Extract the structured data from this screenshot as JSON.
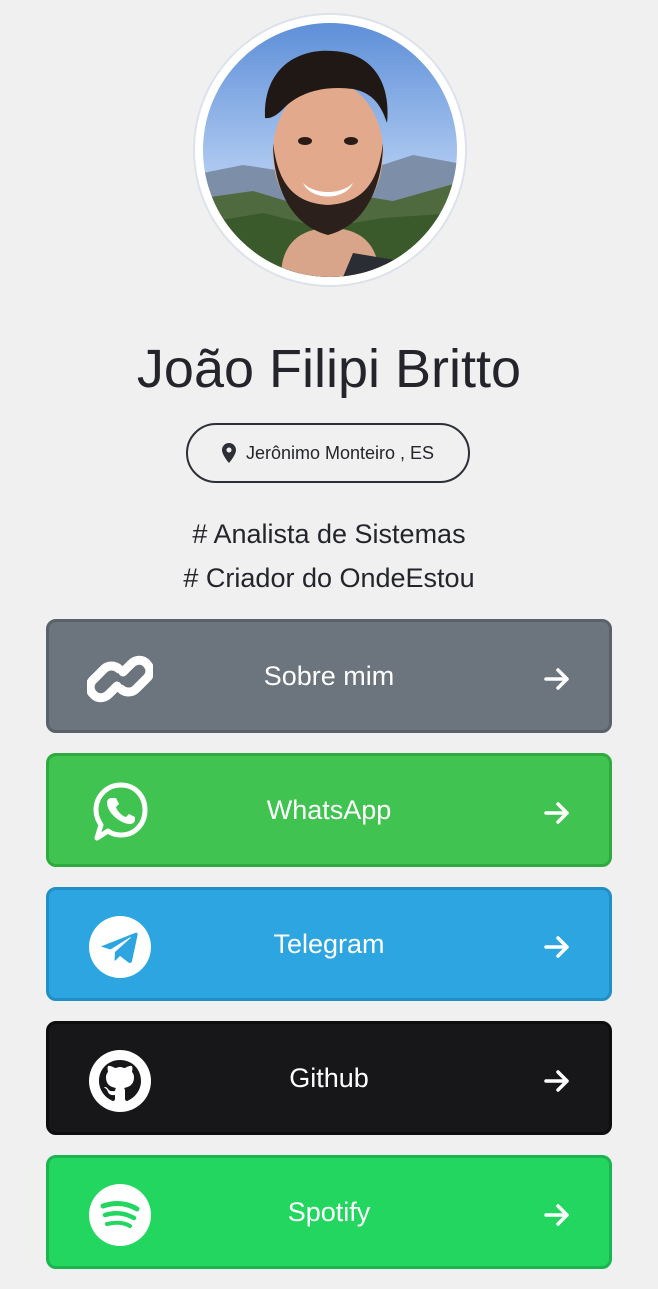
{
  "profile": {
    "name": "João Filipi Britto",
    "location": "Jerônimo Monteiro , ES",
    "tags": [
      "# Analista de Sistemas",
      "# Criador do OndeEstou"
    ]
  },
  "links": [
    {
      "label": "Sobre mim",
      "icon": "link-icon",
      "color": "#6c757d",
      "border": "#5a6169"
    },
    {
      "label": "WhatsApp",
      "icon": "whatsapp-icon",
      "color": "#40c351",
      "border": "#2faa3f"
    },
    {
      "label": "Telegram",
      "icon": "telegram-icon",
      "color": "#2ca5e0",
      "border": "#1f8fc6"
    },
    {
      "label": "Github",
      "icon": "github-icon",
      "color": "#17171a",
      "border": "#0d0d0f"
    },
    {
      "label": "Spotify",
      "icon": "spotify-icon",
      "color": "#22d660",
      "border": "#1ab54f"
    }
  ],
  "colors": {
    "background": "#f0f0f0",
    "text": "#23252b"
  }
}
